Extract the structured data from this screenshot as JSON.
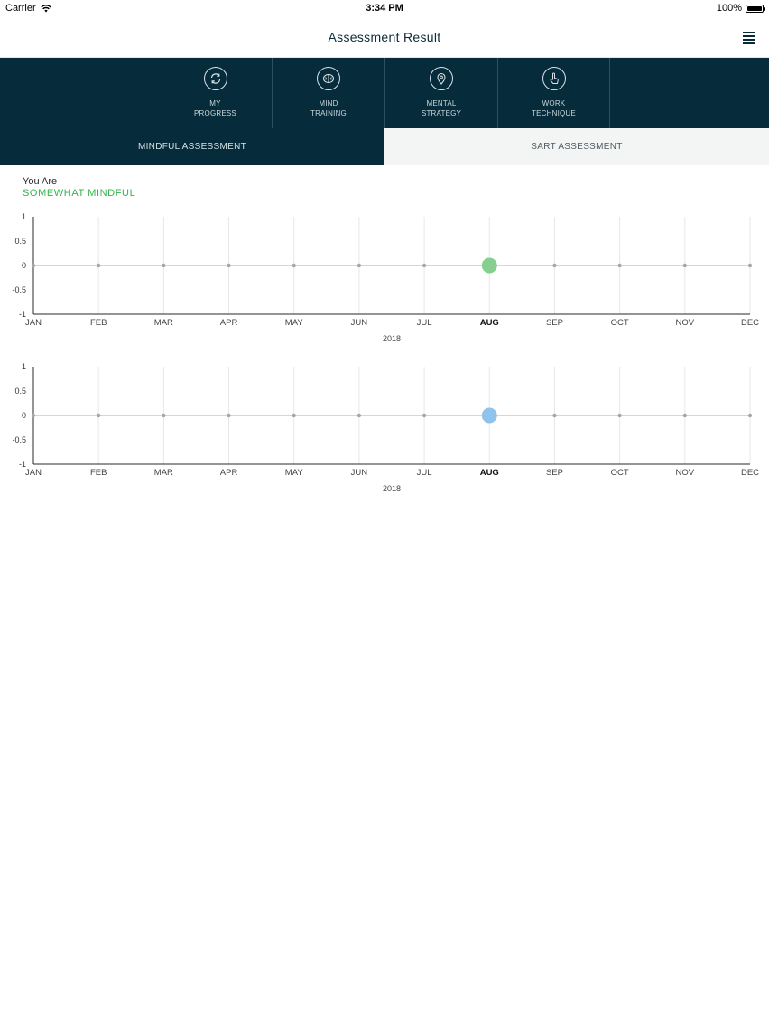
{
  "status_bar": {
    "carrier": "Carrier",
    "time": "3:34 PM",
    "battery": "100%",
    "battery_level": 1.0
  },
  "nav": {
    "title": "Assessment Result",
    "menu_icon": "hamburger-menu-icon"
  },
  "categories": [
    {
      "line1": "MY",
      "line2": "PROGRESS",
      "icon": "refresh-icon"
    },
    {
      "line1": "MIND",
      "line2": "TRAINING",
      "icon": "brain-icon"
    },
    {
      "line1": "MENTAL",
      "line2": "STRATEGY",
      "icon": "location-pin-icon"
    },
    {
      "line1": "WORK",
      "line2": "TECHNIQUE",
      "icon": "pointer-hand-icon"
    }
  ],
  "tabs": {
    "mindful": "MINDFUL ASSESSMENT",
    "sart": "SART ASSESSMENT",
    "active": "mindful"
  },
  "result": {
    "label": "You Are",
    "value": "SOMEWHAT MINDFUL",
    "value_color": "#33b44a"
  },
  "colors": {
    "header_bg": "#062b3a",
    "mindful_point": "#86cf8f",
    "sart_point": "#8fc3ec"
  },
  "chart_data": [
    {
      "type": "line",
      "categories": [
        "JAN",
        "FEB",
        "MAR",
        "APR",
        "MAY",
        "JUN",
        "JUL",
        "AUG",
        "SEP",
        "OCT",
        "NOV",
        "DEC"
      ],
      "highlight_category": "AUG",
      "yticks": [
        "1",
        "0.5",
        "0",
        "-0.5",
        "-1"
      ],
      "ylim": [
        -1,
        1
      ],
      "xlabel": "2018",
      "grid": true,
      "series": [
        {
          "values": [
            0,
            0,
            0,
            0,
            0,
            0,
            0,
            0,
            0,
            0,
            0,
            0
          ],
          "highlight_color": "#86cf8f"
        }
      ]
    },
    {
      "type": "line",
      "categories": [
        "JAN",
        "FEB",
        "MAR",
        "APR",
        "MAY",
        "JUN",
        "JUL",
        "AUG",
        "SEP",
        "OCT",
        "NOV",
        "DEC"
      ],
      "highlight_category": "AUG",
      "yticks": [
        "1",
        "0.5",
        "0",
        "-0.5",
        "-1"
      ],
      "ylim": [
        -1,
        1
      ],
      "xlabel": "2018",
      "grid": true,
      "series": [
        {
          "values": [
            0,
            0,
            0,
            0,
            0,
            0,
            0,
            0,
            0,
            0,
            0,
            0
          ],
          "highlight_color": "#8fc3ec"
        }
      ]
    }
  ]
}
